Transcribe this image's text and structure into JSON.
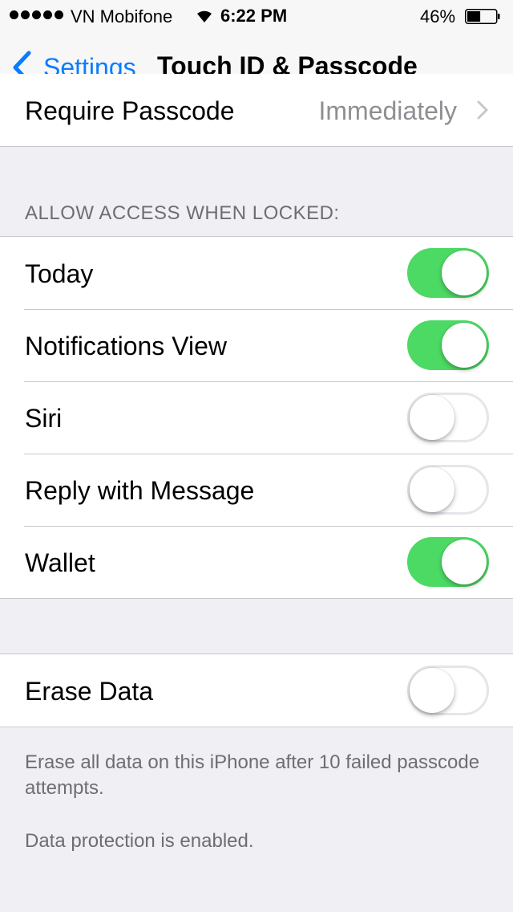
{
  "status_bar": {
    "carrier": "VN Mobifone",
    "time": "6:22 PM",
    "battery_percent": "46%",
    "battery_level": 0.46,
    "signal_bars": 5
  },
  "nav": {
    "back_label": "Settings",
    "title": "Touch ID & Passcode"
  },
  "require_passcode": {
    "label": "Require Passcode",
    "value": "Immediately"
  },
  "allow_access": {
    "header": "ALLOW ACCESS WHEN LOCKED:",
    "items": [
      {
        "label": "Today",
        "on": true
      },
      {
        "label": "Notifications View",
        "on": true
      },
      {
        "label": "Siri",
        "on": false
      },
      {
        "label": "Reply with Message",
        "on": false
      },
      {
        "label": "Wallet",
        "on": true
      }
    ]
  },
  "erase_data": {
    "label": "Erase Data",
    "on": false,
    "footer_1": "Erase all data on this iPhone after 10 failed passcode attempts.",
    "footer_2": "Data protection is enabled."
  },
  "colors": {
    "accent": "#0a7cff",
    "toggle_on": "#4cd964",
    "background": "#efeff4"
  },
  "icons": [
    "signal-dots-icon",
    "wifi-icon",
    "battery-icon",
    "back-chevron-icon",
    "disclosure-chevron-icon"
  ]
}
